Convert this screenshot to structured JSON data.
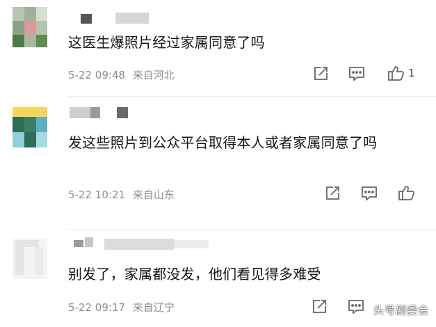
{
  "comments": [
    {
      "text": "这医生爆照片经过家属同意了吗",
      "time": "5-22 09:48",
      "location": "来自河北",
      "likes": "1"
    },
    {
      "text": "发这些照片到公众平台取得本人或者家属同意了吗",
      "time": "5-22 10:21",
      "location": "来自山东",
      "likes": ""
    },
    {
      "text": "别发了，家属都没发，他们看见得多难受",
      "time": "5-22 09:17",
      "location": "来自辽宁",
      "likes": ""
    }
  ],
  "actions": {
    "share_icon": "share-icon",
    "comment_icon": "comment-icon",
    "like_icon": "thumbs-up-icon"
  },
  "watermark": "头号剧委会",
  "colors": {
    "text": "#151515",
    "meta": "#8c8c8c",
    "icon": "#666666",
    "divider": "#ececec"
  }
}
